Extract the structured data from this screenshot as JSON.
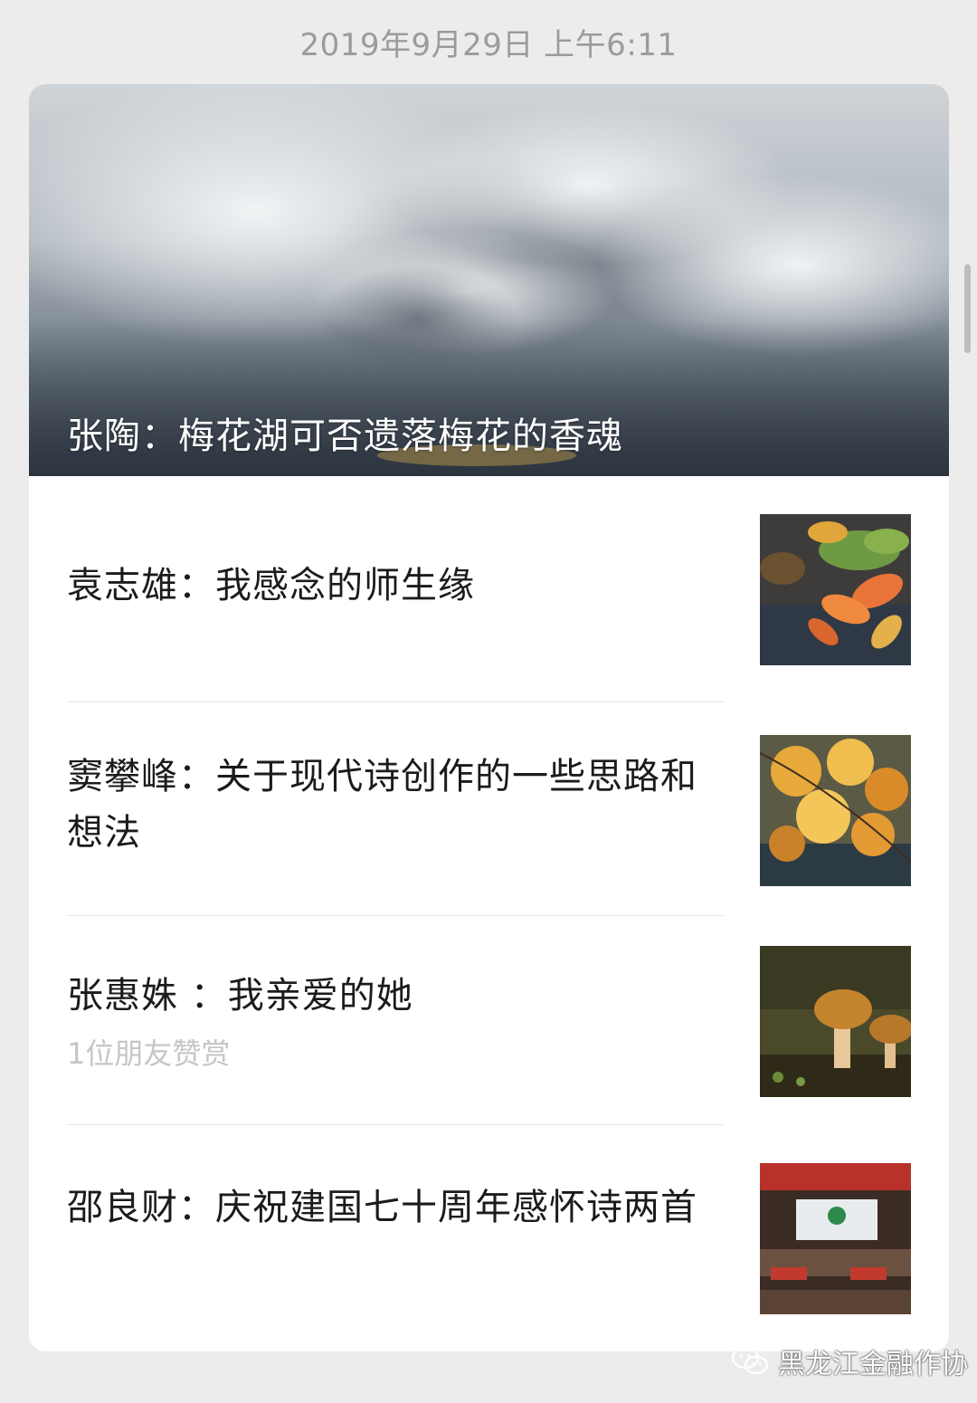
{
  "timestamp": "2019年9月29日 上午6:11",
  "hero": {
    "title": "张陶：梅花湖可否遗落梅花的香魂"
  },
  "articles": [
    {
      "title": "袁志雄：我感念的师生缘",
      "subtitle": "",
      "thumb_icon": "autumn-leaves-image"
    },
    {
      "title": "窦攀峰：关于现代诗创作的一些思路和想法",
      "subtitle": "",
      "thumb_icon": "maple-leaves-image"
    },
    {
      "title": "张惠姝 ：我亲爱的她",
      "subtitle": "1位朋友赞赏",
      "thumb_icon": "mushroom-image"
    },
    {
      "title": "邵良财：庆祝建国七十周年感怀诗两首",
      "subtitle": "",
      "thumb_icon": "meeting-hall-image"
    }
  ],
  "watermark": {
    "text": "黑龙江金融作协",
    "icon": "wechat-icon"
  }
}
